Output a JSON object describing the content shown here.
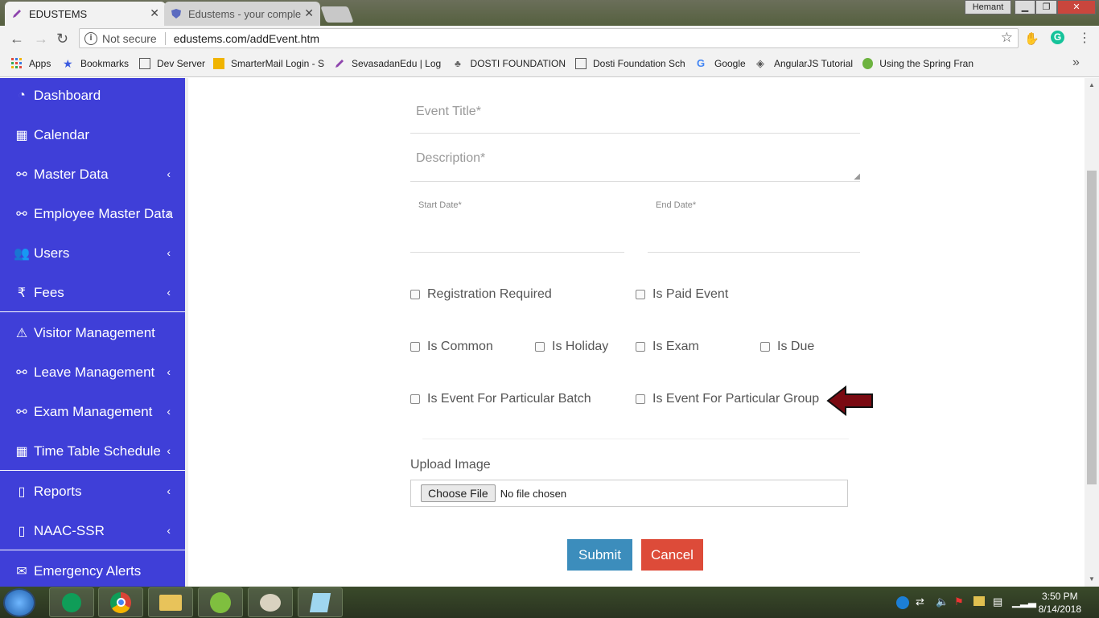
{
  "browser": {
    "tabs": [
      {
        "title": "EDUSTEMS",
        "active": true
      },
      {
        "title": "Edustems - your complet",
        "active": false
      }
    ],
    "user": "Hemant",
    "security": "Not secure",
    "url": "edustems.com/addEvent.htm",
    "bookmarks": [
      "Apps",
      "Bookmarks",
      "Dev Server",
      "SmarterMail Login - S",
      "SevasadanEdu | Log I",
      "DOSTI FOUNDATION",
      "Dosti Foundation Sch",
      "Google",
      "AngularJS Tutorial",
      "Using the Spring Fran"
    ],
    "overflow": "»"
  },
  "sidebar": {
    "items": [
      {
        "label": "Dashboard",
        "icon": "dashboard-icon",
        "chevron": false
      },
      {
        "label": "Calendar",
        "icon": "calendar-icon",
        "chevron": false
      },
      {
        "label": "Master Data",
        "icon": "link-icon",
        "chevron": true
      },
      {
        "label": "Employee Master Data",
        "icon": "link-icon",
        "chevron": true
      },
      {
        "label": "Users",
        "icon": "users-icon",
        "chevron": true
      },
      {
        "label": "Fees",
        "icon": "rupee-icon",
        "chevron": true
      },
      {
        "label": "Visitor Management",
        "icon": "warning-icon",
        "chevron": false
      },
      {
        "label": "Leave Management",
        "icon": "link-icon",
        "chevron": true
      },
      {
        "label": "Exam Management",
        "icon": "link-icon",
        "chevron": true
      },
      {
        "label": "Time Table Schedule",
        "icon": "calendar-icon",
        "chevron": true
      },
      {
        "label": "Reports",
        "icon": "file-icon",
        "chevron": true
      },
      {
        "label": "NAAC-SSR",
        "icon": "file-icon",
        "chevron": true
      },
      {
        "label": "Emergency Alerts",
        "icon": "envelope-icon",
        "chevron": false
      }
    ],
    "chevron_glyph": "‹"
  },
  "form": {
    "event_title_placeholder": "Event Title*",
    "description_placeholder": "Description*",
    "start_date_label": "Start Date*",
    "end_date_label": "End Date*",
    "checkboxes": {
      "registration_required": "Registration Required",
      "is_paid_event": "Is Paid Event",
      "is_common": "Is Common",
      "is_holiday": "Is Holiday",
      "is_exam": "Is Exam",
      "is_due": "Is Due",
      "is_event_for_batch": "Is Event For Particular Batch",
      "is_event_for_group": "Is Event For Particular Group"
    },
    "upload_label": "Upload Image",
    "choose_file": "Choose File",
    "no_file": "No file chosen",
    "submit": "Submit",
    "cancel": "Cancel"
  },
  "taskbar": {
    "time": "3:50 PM",
    "date": "8/14/2018"
  },
  "colors": {
    "sidebar": "#3f3fd8",
    "submit": "#3c8dbc",
    "cancel": "#dd4b39",
    "arrow": "#7a0a12"
  }
}
